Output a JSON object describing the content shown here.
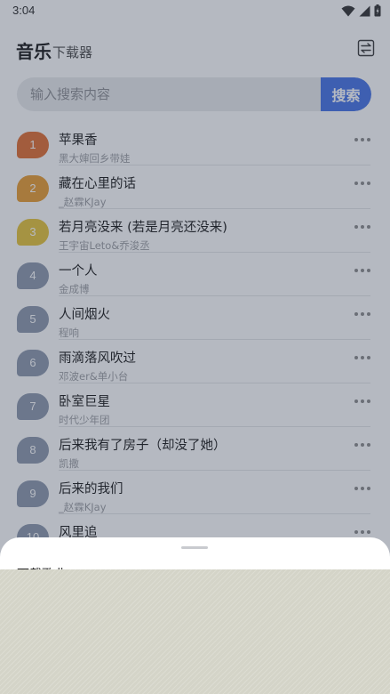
{
  "status_bar": {
    "time": "3:04"
  },
  "header": {
    "title": "音乐",
    "subtitle": "下载器"
  },
  "search": {
    "placeholder": "输入搜索内容",
    "button_label": "搜索"
  },
  "songs": [
    {
      "rank": "1",
      "title": "苹果香",
      "artist": "黑大婶回乡带娃",
      "badge_color": "#e0692a"
    },
    {
      "rank": "2",
      "title": "藏在心里的话",
      "artist": "_赵霖KJay",
      "badge_color": "#e89a2a"
    },
    {
      "rank": "3",
      "title": "若月亮没来 (若是月亮还没来)",
      "artist": "王宇宙Leto&乔浚丞",
      "badge_color": "#e6c232"
    },
    {
      "rank": "4",
      "title": "一个人",
      "artist": "金成博",
      "badge_color": "#8995aa"
    },
    {
      "rank": "5",
      "title": "人间烟火",
      "artist": "程响",
      "badge_color": "#8995aa"
    },
    {
      "rank": "6",
      "title": "雨滴落风吹过",
      "artist": "邓波er&单小台",
      "badge_color": "#8995aa"
    },
    {
      "rank": "7",
      "title": "卧室巨星",
      "artist": "时代少年团",
      "badge_color": "#8995aa"
    },
    {
      "rank": "8",
      "title": "后来我有了房子（却没了她）",
      "artist": "凯撒",
      "badge_color": "#8995aa"
    },
    {
      "rank": "9",
      "title": "后来的我们",
      "artist": "_赵霖KJay",
      "badge_color": "#8995aa"
    },
    {
      "rank": "10",
      "title": "风里追",
      "artist": "",
      "badge_color": "#8995aa"
    }
  ],
  "sheet": {
    "title": "下载歌曲"
  }
}
